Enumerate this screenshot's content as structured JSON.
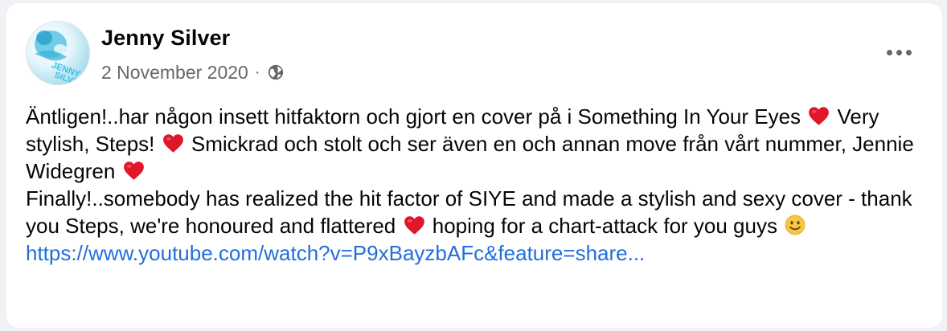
{
  "post": {
    "author": "Jenny Silver",
    "date": "2 November 2020",
    "separator": "·",
    "avatar_text": "JENNY SILVER",
    "visibility_icon": "globe-icon",
    "more_icon": "more-options-icon",
    "text": {
      "seg1": "Äntligen!..har någon insett hitfaktorn och gjort en cover på i Something In Your Eyes",
      "seg2": "Very stylish, Steps!",
      "seg3": "Smickrad och stolt och ser även en och annan move från vårt nummer, Jennie Widegren",
      "seg4": "Finally!..somebody has realized the hit factor of SIYE and made a stylish and sexy cover - thank you Steps, we're honoured and flattered",
      "seg5": "hoping for a chart-attack for you guys"
    },
    "link": "https://www.youtube.com/watch?v=P9xBayzbAFc&feature=share..."
  },
  "colors": {
    "link": "#216fdb",
    "secondary_text": "#65676b",
    "heart": "#e0162b"
  }
}
